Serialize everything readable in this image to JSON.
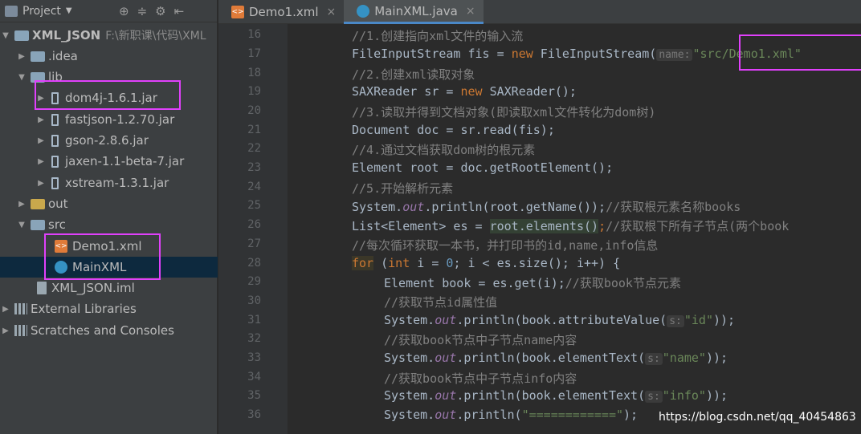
{
  "project": {
    "title": "Project"
  },
  "tree": [
    {
      "label": "XML_JSON",
      "sub": "F:\\新职课\\代码\\XML",
      "type": "module"
    },
    {
      "label": ".idea",
      "type": "folder"
    },
    {
      "label": "lib",
      "type": "folder"
    },
    {
      "label": "dom4j-1.6.1.jar",
      "type": "jar"
    },
    {
      "label": "fastjson-1.2.70.jar",
      "type": "jar"
    },
    {
      "label": "gson-2.8.6.jar",
      "type": "jar"
    },
    {
      "label": "jaxen-1.1-beta-7.jar",
      "type": "jar"
    },
    {
      "label": "xstream-1.3.1.jar",
      "type": "jar"
    },
    {
      "label": "out",
      "type": "folder"
    },
    {
      "label": "src",
      "type": "folder"
    },
    {
      "label": "Demo1.xml",
      "type": "xml"
    },
    {
      "label": "MainXML",
      "type": "java"
    },
    {
      "label": "XML_JSON.iml",
      "type": "iml"
    },
    {
      "label": "External Libraries",
      "type": "lib"
    },
    {
      "label": "Scratches and Consoles",
      "type": "lib"
    }
  ],
  "tabs": [
    {
      "label": "Demo1.xml"
    },
    {
      "label": "MainXML.java"
    }
  ],
  "lines": [
    "16",
    "17",
    "18",
    "19",
    "20",
    "21",
    "22",
    "23",
    "24",
    "25",
    "26",
    "27",
    "28",
    "29",
    "30",
    "31",
    "32",
    "33",
    "34",
    "35",
    "36"
  ],
  "code": {
    "c16": "//1.创建指向xml文件的输入流",
    "c17a": "FileInputStream fis = ",
    "c17b": "new",
    "c17c": " FileInputStream(",
    "c17h": "name:",
    "c17s": "\"src/Demo1.xml\"",
    "c18": "//2.创建xml读取对象",
    "c19a": "SAXReader sr = ",
    "c19b": "new",
    "c19c": " SAXReader();",
    "c20": "//3.读取并得到文档对象(即读取xml文件转化为dom树)",
    "c21": "Document doc = sr.read(fis);",
    "c22": "//4.通过文档获取dom树的根元素",
    "c23": "Element root = doc.getRootElement();",
    "c24": "//5.开始解析元素",
    "c25a": "System.",
    "c25b": "out",
    "c25c": ".println(root.getName());",
    "c25d": "//获取根元素名称books",
    "c26a": "List<Element> es = ",
    "c26b": "root.elements()",
    "c26c": ";",
    "c26d": "//获取根下所有子节点(两个book",
    "c27": "//每次循环获取一本书，并打印书的id,name,info信息",
    "c28a": "for",
    "c28b": " (",
    "c28c": "int",
    "c28d": " i = ",
    "c28e": "0",
    "c28f": "; i < es.size(); i++) {",
    "c29a": "Element book = es.get(i);",
    "c29b": "//获取book节点元素",
    "c30": "//获取节点id属性值",
    "c31a": "System.",
    "c31b": "out",
    "c31c": ".println(book.attributeValue(",
    "c31h": "s:",
    "c31s": "\"id\"",
    "c31e": "));",
    "c32": "//获取book节点中子节点name内容",
    "c33a": "System.",
    "c33b": "out",
    "c33c": ".println(book.elementText(",
    "c33h": "s:",
    "c33s": "\"name\"",
    "c33e": "));",
    "c34": "//获取book节点中子节点info内容",
    "c35a": "System.",
    "c35b": "out",
    "c35c": ".println(book.elementText(",
    "c35h": "s:",
    "c35s": "\"info\"",
    "c35e": "));",
    "c36a": "System.",
    "c36b": "out",
    "c36c": ".println(",
    "c36s": "\"============\"",
    "c36e": ");"
  },
  "watermark": "https://blog.csdn.net/qq_40454863"
}
